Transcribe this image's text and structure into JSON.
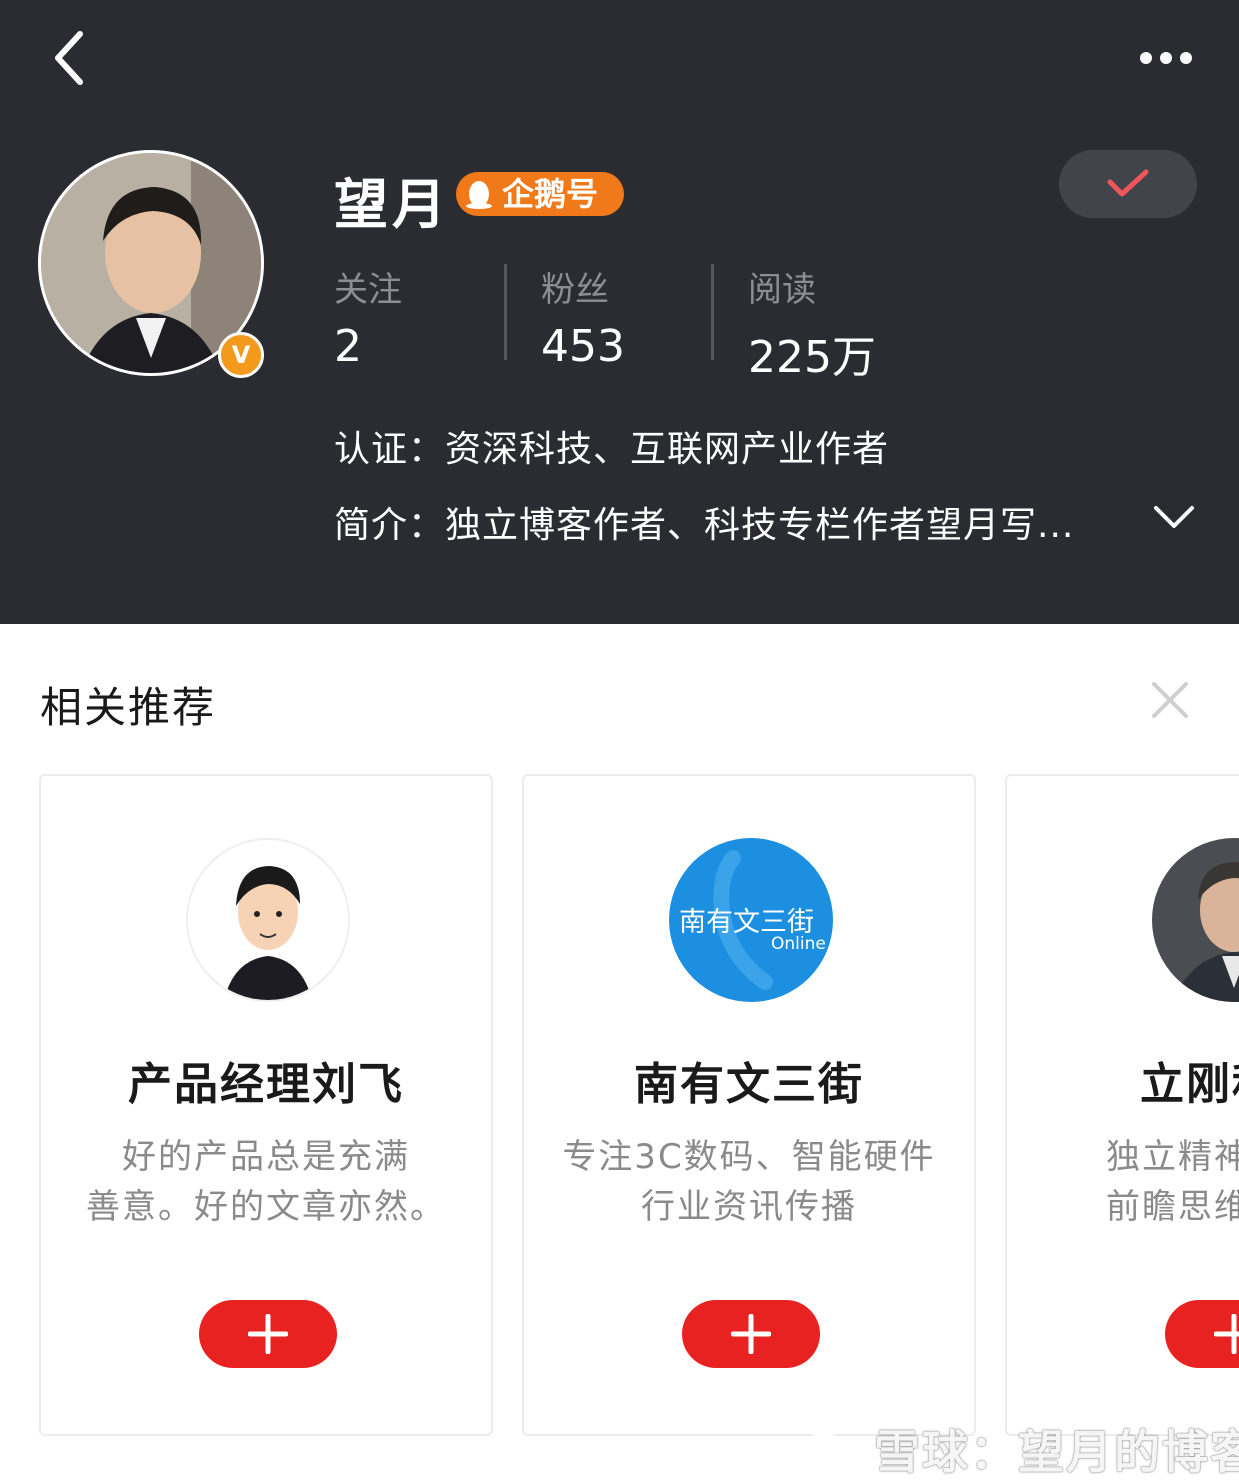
{
  "header": {
    "name": "望月",
    "brand_badge": "企鹅号",
    "avatar_badge": "V",
    "stats": [
      {
        "label": "关注",
        "value": "2"
      },
      {
        "label": "粉丝",
        "value": "453"
      },
      {
        "label": "阅读",
        "value": "225万"
      }
    ],
    "certification": "认证：资深科技、互联网产业作者",
    "intro": "简介：独立博客作者、科技专栏作者望月写..."
  },
  "recommend": {
    "title": "相关推荐",
    "cards": [
      {
        "name": "产品经理刘飞",
        "desc": "好的产品总是充满\n善意。好的文章亦然。"
      },
      {
        "name": "南有文三街",
        "desc": "专注3C数码、智能硬件\n行业资讯传播",
        "logo_text": "南有文三街",
        "logo_sub": "Online"
      },
      {
        "name": "立刚科技",
        "desc": "独立精神、态度\n前瞻思维、深度"
      }
    ]
  },
  "watermark": "雪球：望月的博客",
  "colors": {
    "header_bg": "#2a2c31",
    "accent_red": "#e82221",
    "badge_orange": "#f07a1a",
    "check_red": "#f0565a"
  }
}
